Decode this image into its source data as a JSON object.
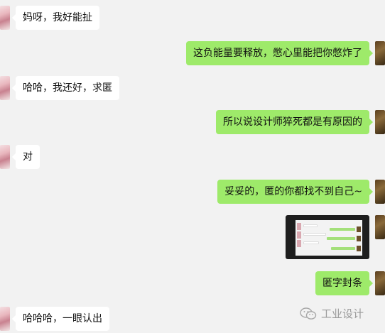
{
  "messages": [
    {
      "side": "in",
      "text": "妈呀，我好能扯"
    },
    {
      "side": "out",
      "text": "这负能量要释放，憋心里能把你憋炸了"
    },
    {
      "side": "in",
      "text": "哈哈，我还好，求匿"
    },
    {
      "side": "out",
      "text": "所以说设计师猝死都是有原因的"
    },
    {
      "side": "in",
      "text": "对"
    },
    {
      "side": "out",
      "text": "妥妥的，匿的你都找不到自己~"
    },
    {
      "side": "out",
      "text": "匿字封条"
    },
    {
      "side": "in",
      "text": "哈哈哈，一眼认出"
    }
  ],
  "watermark": {
    "text": "工业设计",
    "icon": "wechat-icon"
  },
  "colors": {
    "background": "#f2f2f2",
    "incoming_bubble": "#ffffff",
    "outgoing_bubble": "#9eea6a"
  }
}
